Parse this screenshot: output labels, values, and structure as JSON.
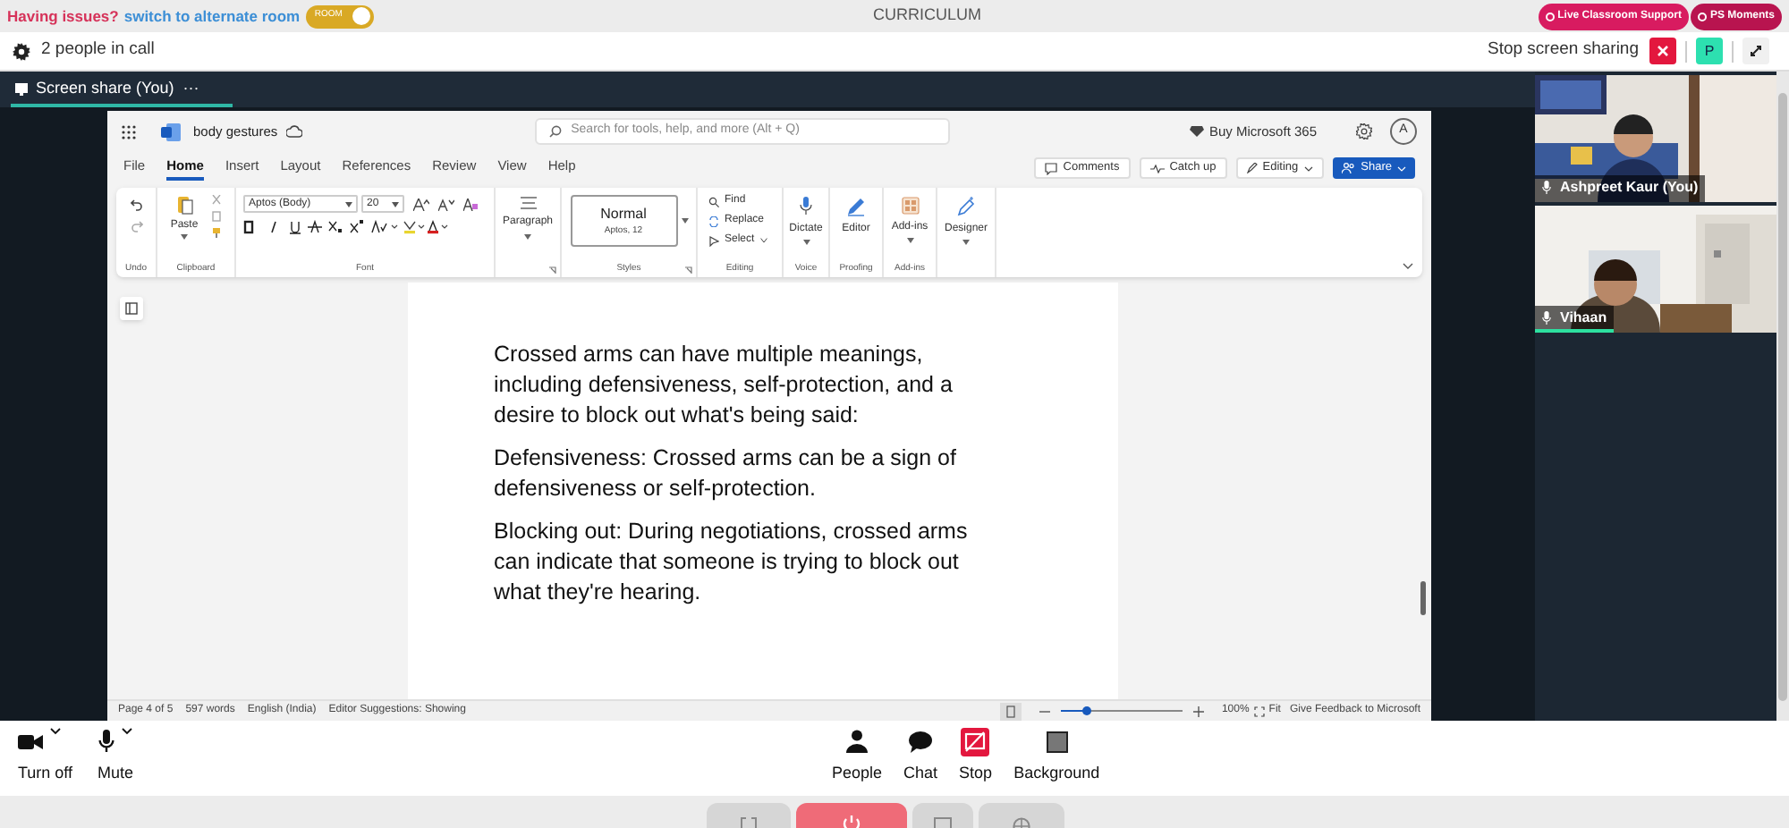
{
  "banner": {
    "issue": "Having issues?",
    "link": "switch to alternate room",
    "toggle": {
      "label": "ROOM",
      "on": true
    }
  },
  "app_title": "CURRICULUM",
  "support_buttons": [
    "Live Classroom Support",
    "PS Moments"
  ],
  "call_bar": {
    "people_count": "2 people in call",
    "stop_sharing": "Stop screen sharing",
    "presenter": "P"
  },
  "share_tab": {
    "label": "Screen share (You)",
    "more": "···"
  },
  "word": {
    "doc_name": "body gestures",
    "search_placeholder": "Search for tools, help, and more (Alt + Q)",
    "buy": "Buy Microsoft 365",
    "account": "A",
    "tabs": [
      {
        "label": "File",
        "selected": false
      },
      {
        "label": "Home",
        "selected": true
      },
      {
        "label": "Insert",
        "selected": false
      },
      {
        "label": "Layout",
        "selected": false
      },
      {
        "label": "References",
        "selected": false
      },
      {
        "label": "Review",
        "selected": false
      },
      {
        "label": "View",
        "selected": false
      },
      {
        "label": "Help",
        "selected": false
      }
    ],
    "actions": [
      {
        "label": "Comments",
        "kind": "comments"
      },
      {
        "label": "Catch up",
        "kind": "catchup"
      },
      {
        "label": "Editing",
        "kind": "editing"
      },
      {
        "label": "Share",
        "kind": "share"
      }
    ],
    "ribbon": {
      "paste": "Paste",
      "font": "Aptos (Body)",
      "size": "20",
      "paragraph": "Paragraph",
      "style": "Normal",
      "style_font": "Aptos, 12",
      "editing": [
        "Find",
        "Replace",
        "Select"
      ],
      "tools": [
        "Dictate",
        "Editor",
        "Add-ins",
        "Designer"
      ],
      "groups": [
        "Undo",
        "Clipboard",
        "Font",
        "Styles",
        "Editing",
        "Voice",
        "Proofing",
        "Add-ins"
      ]
    },
    "paragraphs": [
      "Crossed arms can have multiple meanings, including defensiveness, self-protection, and a desire to block out what's being said:",
      "Defensiveness: Crossed arms can be a sign of defensiveness or self-protection.",
      "Blocking out: During negotiations, crossed arms can indicate that someone is trying to block out what they're hearing."
    ],
    "status": [
      "Page 4 of 5",
      "597 words",
      "English (India)",
      "Editor Suggestions: Showing"
    ],
    "zoom": {
      "level": 0.22,
      "percent": "100%",
      "fit": "Fit"
    },
    "feedback": "Give Feedback to Microsoft"
  },
  "participants": [
    {
      "name": "Ashpreet Kaur (You)",
      "speaking": false
    },
    {
      "name": "Vihaan",
      "speaking": true
    }
  ],
  "controls": [
    {
      "label": "Turn off",
      "kind": "camera",
      "menu": true
    },
    {
      "label": "Mute",
      "kind": "mic",
      "menu": true
    },
    {
      "label": "People",
      "kind": "people",
      "menu": false
    },
    {
      "label": "Chat",
      "kind": "chat",
      "menu": false
    },
    {
      "label": "Stop",
      "kind": "stop",
      "menu": false
    },
    {
      "label": "Background",
      "kind": "background",
      "menu": false
    }
  ],
  "dock": [
    {
      "kind": "fullscreen"
    },
    {
      "kind": "power"
    },
    {
      "kind": "screen"
    },
    {
      "kind": "globe"
    }
  ]
}
